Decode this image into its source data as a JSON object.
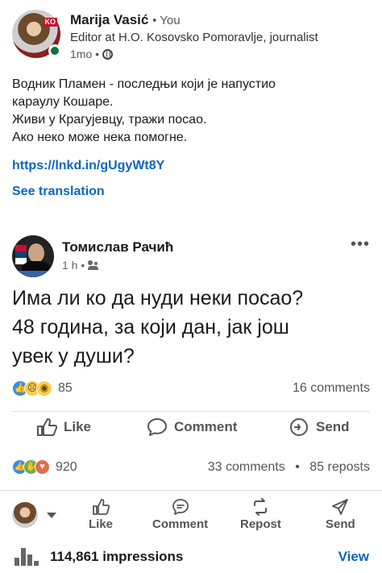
{
  "post": {
    "author": "Marija Vasić",
    "you_label": "• You",
    "headline": "Editor at H.O. Kosovsko Pomoravlje, journalist",
    "age": "1mo •",
    "avatar_badge": "KO",
    "body_lines": [
      "Водник Пламен - последњи који је напустио",
      "караулу Кошаре.",
      "Живи у Крагујевцу, тражи посао.",
      "Ако неко може нека помогне."
    ],
    "link": "https://lnkd.in/gUgyWt8Y",
    "see_translation": "See translation"
  },
  "shared_post": {
    "author": "Томислав Рачић",
    "age": "1 h •",
    "more_label": "•••",
    "body_lines": [
      "Има ли ко да нуди неки посао?",
      "48 година, за који дан, јак још",
      "увек у души?"
    ],
    "reaction_count": "85",
    "comments": "16 comments",
    "actions": {
      "like": "Like",
      "comment": "Comment",
      "send": "Send"
    }
  },
  "stats": {
    "reaction_count": "920",
    "comments": "33 comments",
    "separator": "•",
    "reposts": "85 reposts"
  },
  "bottom_bar": {
    "like": "Like",
    "comment": "Comment",
    "repost": "Repost",
    "send": "Send"
  },
  "impressions": {
    "label": "114,861 impressions",
    "view": "View"
  },
  "colors": {
    "brand_blue": "#0a66c2",
    "online_green": "#057642",
    "like_blue": "#378fe9"
  },
  "icons": [
    "globe-icon",
    "people-icon",
    "thumbs-up-icon",
    "comment-icon",
    "send-icon",
    "repost-icon",
    "bar-chart-icon",
    "caret-down-icon"
  ]
}
